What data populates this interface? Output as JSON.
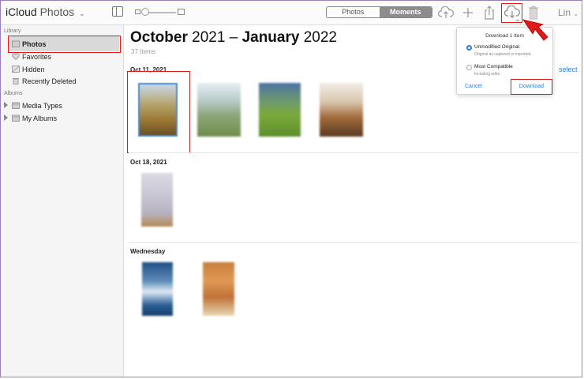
{
  "app": {
    "brand": "iCloud",
    "name": "Photos"
  },
  "toolbar": {
    "segments": [
      {
        "label": "Photos",
        "active": false
      },
      {
        "label": "Moments",
        "active": true
      }
    ],
    "user": "Lin"
  },
  "sidebar": {
    "library_label": "Library",
    "albums_label": "Albums",
    "library_items": [
      {
        "label": "Photos",
        "icon": "photos-icon",
        "selected": true
      },
      {
        "label": "Favorites",
        "icon": "heart-icon"
      },
      {
        "label": "Hidden",
        "icon": "hidden-icon"
      },
      {
        "label": "Recently Deleted",
        "icon": "trash-icon"
      }
    ],
    "album_items": [
      {
        "label": "Media Types",
        "icon": "folder-icon"
      },
      {
        "label": "My Albums",
        "icon": "folder-icon"
      }
    ]
  },
  "main": {
    "title_month1": "October",
    "title_year1": "2021",
    "title_dash": "–",
    "title_month2": "January",
    "title_year2": "2022",
    "count": "37 Items",
    "select_link": "select",
    "groups": [
      {
        "date": "Oct 11, 2021",
        "photos": 4
      },
      {
        "date": "Oct 18, 2021",
        "photos": 1
      },
      {
        "date": "Wednesday",
        "photos": 2
      }
    ]
  },
  "download_popover": {
    "title": "Download 1 Item",
    "options": [
      {
        "label": "Unmodified Original",
        "desc": "Original as captured or imported.",
        "selected": true
      },
      {
        "label": "Most Compatible",
        "desc": "Including edits.",
        "selected": false
      }
    ],
    "cancel": "Cancel",
    "download": "Download"
  },
  "colors": {
    "accent": "#2b7de1",
    "highlight": "#e01a1a"
  }
}
